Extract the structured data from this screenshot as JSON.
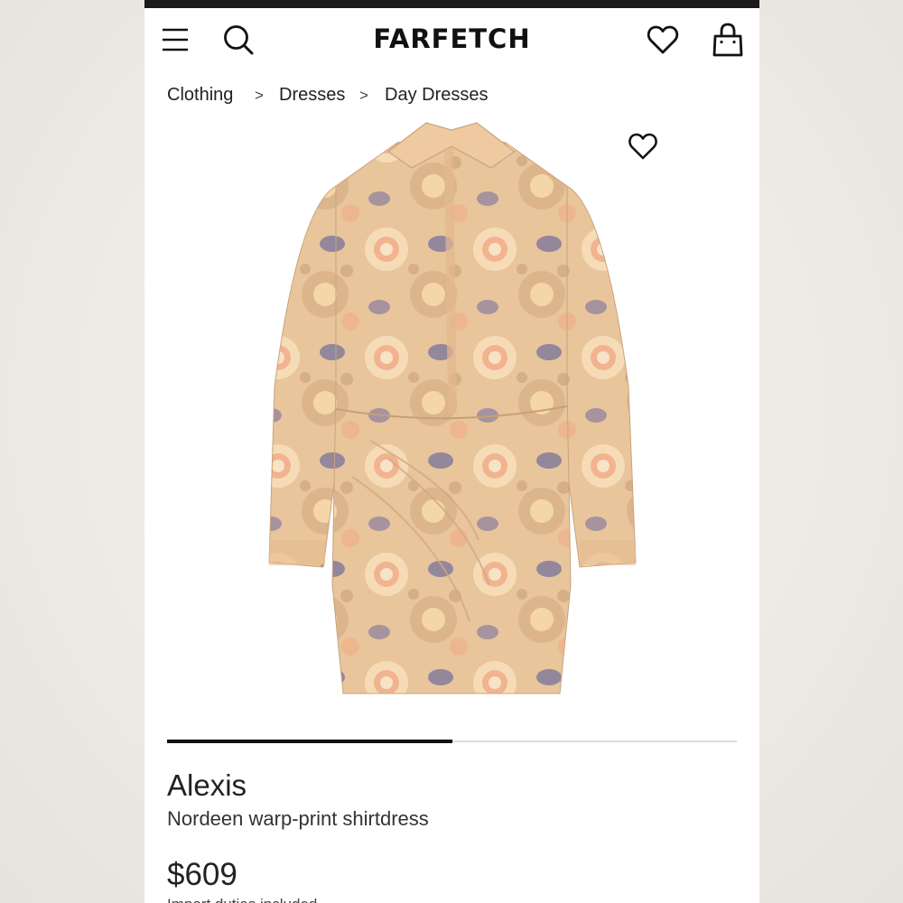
{
  "header": {
    "brand": "FARFETCH",
    "menu_icon": "menu-icon",
    "search_icon": "search-icon",
    "wishlist_icon": "heart-icon",
    "bag_icon": "shopping-bag-icon"
  },
  "breadcrumb": {
    "items": [
      "Clothing",
      "Dresses",
      "Day Dresses"
    ],
    "separator": ">"
  },
  "gallery": {
    "image_alt": "Nordeen warp-print shirtdress",
    "favorite_icon": "heart-icon",
    "progress": 0.5
  },
  "product": {
    "brand": "Alexis",
    "name": "Nordeen warp-print shirtdress",
    "price": "$609",
    "price_note": "Import duties included"
  },
  "colors": {
    "bar": "#1a1a1a",
    "text": "#222222",
    "progress_track": "#dcdcdc",
    "progress_fill": "#111111"
  }
}
